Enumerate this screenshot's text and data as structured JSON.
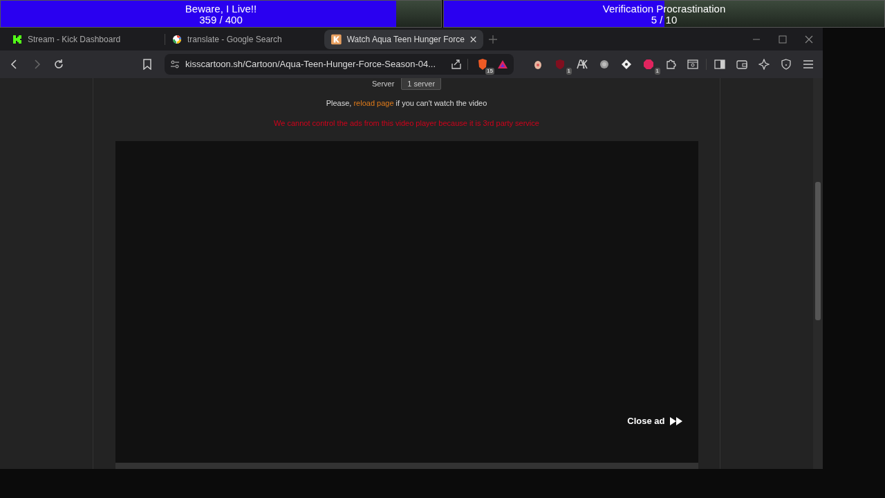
{
  "meters": [
    {
      "title": "Beware, I Live!!",
      "reading": "359 / 400",
      "level": 0.8975
    },
    {
      "title": "Verification Procrastination",
      "reading": "5 / 10",
      "level": 0.5
    }
  ],
  "tabs": [
    {
      "title": "Stream - Kick Dashboard",
      "kind": "kick",
      "selected": false
    },
    {
      "title": "translate - Google Search",
      "kind": "google",
      "selected": false
    },
    {
      "title": "Watch Aqua Teen Hunger Force",
      "kind": "kiss",
      "selected": true
    }
  ],
  "address": {
    "url": "kisscartoon.sh/Cartoon/Aqua-Teen-Hunger-Force-Season-04..."
  },
  "shield_badge": "15",
  "extensions": [
    {
      "kind": "egg"
    },
    {
      "kind": "ublock",
      "badge": "1"
    },
    {
      "kind": "ak"
    },
    {
      "kind": "circle"
    },
    {
      "kind": "diamond"
    },
    {
      "kind": "adblock",
      "badge": "1"
    },
    {
      "kind": "puzzle"
    },
    {
      "kind": "screen"
    }
  ],
  "page": {
    "server_label": "Server",
    "server_value": "1 server",
    "notice_before": "Please,",
    "notice_link": "reload page",
    "notice_after": "if you can't watch the video",
    "warning": "We cannot control the ads from this video player because it is 3rd party service",
    "close_ad": "Close ad"
  }
}
